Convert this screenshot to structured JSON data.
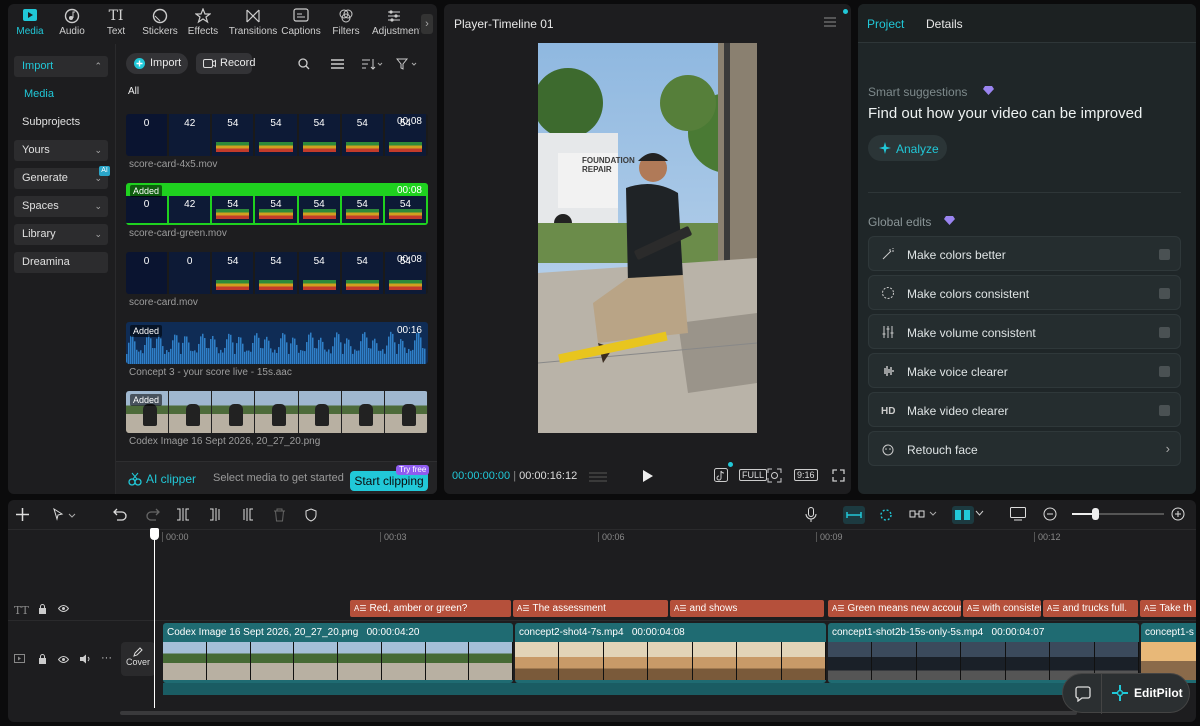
{
  "tabs": [
    {
      "label": "Media",
      "active": true
    },
    {
      "label": "Audio"
    },
    {
      "label": "Text"
    },
    {
      "label": "Stickers"
    },
    {
      "label": "Effects"
    },
    {
      "label": "Transitions"
    },
    {
      "label": "Captions"
    },
    {
      "label": "Filters"
    },
    {
      "label": "Adjustment"
    }
  ],
  "sidebar": {
    "items": [
      {
        "label": "Import"
      },
      {
        "label": "Media"
      },
      {
        "label": "Subprojects"
      },
      {
        "label": "Yours"
      },
      {
        "label": "Generate"
      },
      {
        "label": "Spaces"
      },
      {
        "label": "Library"
      },
      {
        "label": "Dreamina"
      }
    ],
    "ai_badge": "AI"
  },
  "media": {
    "import_label": "Import",
    "record_label": "Record",
    "all_label": "All",
    "items": [
      {
        "name": "score-card-4x5.mov",
        "duration": "00:08",
        "added": "",
        "values": [
          "0",
          "42",
          "54",
          "54",
          "54",
          "54",
          "54"
        ]
      },
      {
        "name": "score-card-green.mov",
        "duration": "00:08",
        "added": "Added",
        "values": [
          "0",
          "42",
          "54",
          "54",
          "54",
          "54",
          "54"
        ]
      },
      {
        "name": "score-card.mov",
        "duration": "00:08",
        "added": "",
        "values": [
          "0",
          "0",
          "54",
          "54",
          "54",
          "54",
          "54"
        ]
      },
      {
        "name": "Concept 3 - your score live - 15s.aac",
        "duration": "00:16",
        "added": "Added"
      },
      {
        "name": "Codex Image 16 Sept 2026, 20_27_20.png",
        "duration": "",
        "added": "Added"
      }
    ],
    "clipper": {
      "label": "AI clipper",
      "hint": "Select media to get started",
      "button": "Start clipping",
      "badge": "Try free"
    }
  },
  "player": {
    "title": "Player-Timeline 01",
    "current_time": "00:00:00:00",
    "total_time": "00:00:16:12",
    "ratio": "9:16",
    "van_text": "FOUNDATION REPAIR"
  },
  "right": {
    "tabs": [
      "Project",
      "Details"
    ],
    "smart_label": "Smart suggestions",
    "smart_title": "Find out how your video can be improved",
    "analyze": "Analyze",
    "global_label": "Global edits",
    "edits": [
      {
        "label": "Make colors better",
        "icon": "magic-wand-icon"
      },
      {
        "label": "Make colors consistent",
        "icon": "palette-icon"
      },
      {
        "label": "Make volume consistent",
        "icon": "sliders-icon"
      },
      {
        "label": "Make voice clearer",
        "icon": "waveform-icon"
      },
      {
        "label": "Make video clearer",
        "icon": "hd-icon"
      },
      {
        "label": "Retouch face",
        "icon": "face-icon"
      }
    ]
  },
  "timeline": {
    "ruler": [
      "00:00",
      "00:03",
      "00:06",
      "00:09",
      "00:12"
    ],
    "text_clips": [
      "Red, amber or green?",
      "The assessment",
      "and shows",
      "Green means new accounts",
      "with consisten",
      "and trucks full.",
      "Take th"
    ],
    "video_clips": [
      {
        "name": "Codex Image 16 Sept 2026, 20_27_20.png",
        "duration": "00:00:04:20"
      },
      {
        "name": "concept2-shot4-7s.mp4",
        "duration": "00:00:04:08"
      },
      {
        "name": "concept1-shot2b-15s-only-5s.mp4",
        "duration": "00:00:04:07"
      },
      {
        "name": "concept1-s",
        "duration": ""
      }
    ],
    "cover_label": "Cover",
    "text_track_icon": "TT"
  },
  "editpilot": "EditPilot",
  "colors": {
    "accent": "#21c8d8",
    "text_clip": "#b5503b",
    "video_clip": "#1f6b72",
    "clipper_btn": "#21c8d8"
  }
}
